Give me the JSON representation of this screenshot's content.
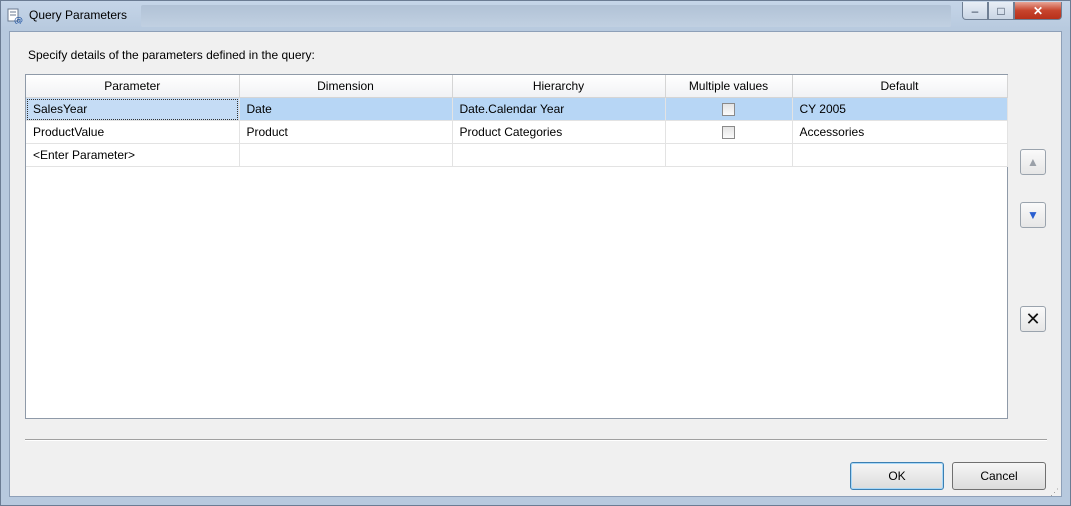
{
  "window": {
    "title": "Query Parameters",
    "minimize_glyph": "–",
    "maximize_glyph": "□",
    "close_glyph": "✕"
  },
  "dialog": {
    "instructions": "Specify details of the parameters defined in the query:",
    "columns": [
      "Parameter",
      "Dimension",
      "Hierarchy",
      "Multiple values",
      "Default"
    ],
    "rows": [
      {
        "parameter": "SalesYear",
        "dimension": "Date",
        "hierarchy": "Date.Calendar Year",
        "multiple_values": false,
        "default": "CY 2005",
        "selected": true
      },
      {
        "parameter": "ProductValue",
        "dimension": "Product",
        "hierarchy": "Product Categories",
        "multiple_values": false,
        "default": "Accessories",
        "selected": false
      }
    ],
    "new_row": {
      "parameter": "<Enter Parameter>"
    },
    "side_buttons": {
      "up_glyph": "▲",
      "down_glyph": "▼",
      "delete_glyph": "✕"
    },
    "buttons": {
      "ok": "OK",
      "cancel": "Cancel"
    }
  },
  "colors": {
    "selection": "#b7d6f5",
    "accent": "#3c7fb1"
  }
}
